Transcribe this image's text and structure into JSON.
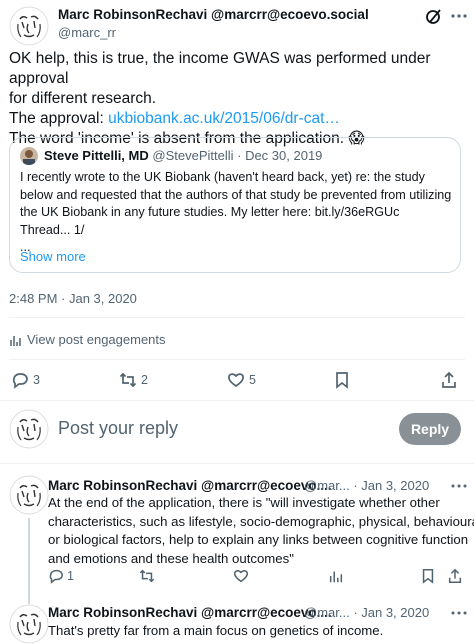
{
  "main_tweet": {
    "author_name": "Marc RobinsonRechavi @marcrr@ecoevo.social",
    "author_handle": "@marc_rr",
    "line1": "OK help, this is true, the income GWAS was performed under approval",
    "line2": "for different research.",
    "line3_prefix": "The approval: ",
    "line3_link": "ukbiobank.ac.uk/2015/06/dr-cat…",
    "line4": "The word 'income' is absent from the application. 😱",
    "timestamp": "2:48 PM · Jan 3, 2020",
    "engagements_label": "View post engagements",
    "reply_count": "3",
    "retweet_count": "2",
    "like_count": "5"
  },
  "quoted_tweet": {
    "author_name": "Steve Pittelli, MD",
    "author_handle": "@StevePittelli",
    "date": "· Dec 30, 2019",
    "line1": "I recently wrote to the UK Biobank (haven't heard back, yet) re: the study",
    "line2": "below and requested that the authors of that study be prevented from utilizing",
    "line3": "the UK Biobank in any future studies. My letter here: bit.ly/36eRGUc",
    "line4": "Thread... 1/",
    "line5": "...",
    "show_more": "Show more"
  },
  "compose": {
    "placeholder": "Post your reply",
    "reply_button": "Reply"
  },
  "replies": [
    {
      "author_name": "Marc RobinsonRechavi @marcrr@ecoevo....",
      "meta": "@mar... · Jan 3, 2020",
      "line1": "At the end of the application, there is \"will investigate whether other",
      "line2": "characteristics, such as lifestyle, socio-demographic, physical, behavioural",
      "line3": "or biological factors, help to explain any links between cognitive function",
      "line4": "and emotions and these health outcomes\"",
      "reply_count": "1"
    },
    {
      "author_name": "Marc RobinsonRechavi @marcrr@ecoevo....",
      "meta": "@mar... · Jan 3, 2020",
      "line1": "That's pretty far from a main focus on genetics of income."
    }
  ],
  "icons": {
    "more": "more-icon",
    "grok": "grok-icon",
    "reply": "reply-icon",
    "retweet": "retweet-icon",
    "like": "heart-icon",
    "bookmark": "bookmark-icon",
    "share": "share-icon",
    "analytics": "analytics-icon"
  },
  "colors": {
    "link": "#1d9bf0",
    "secondary_text": "#536471",
    "reply_button_bg": "#8a9196",
    "thread_line": "#cfd9de"
  }
}
